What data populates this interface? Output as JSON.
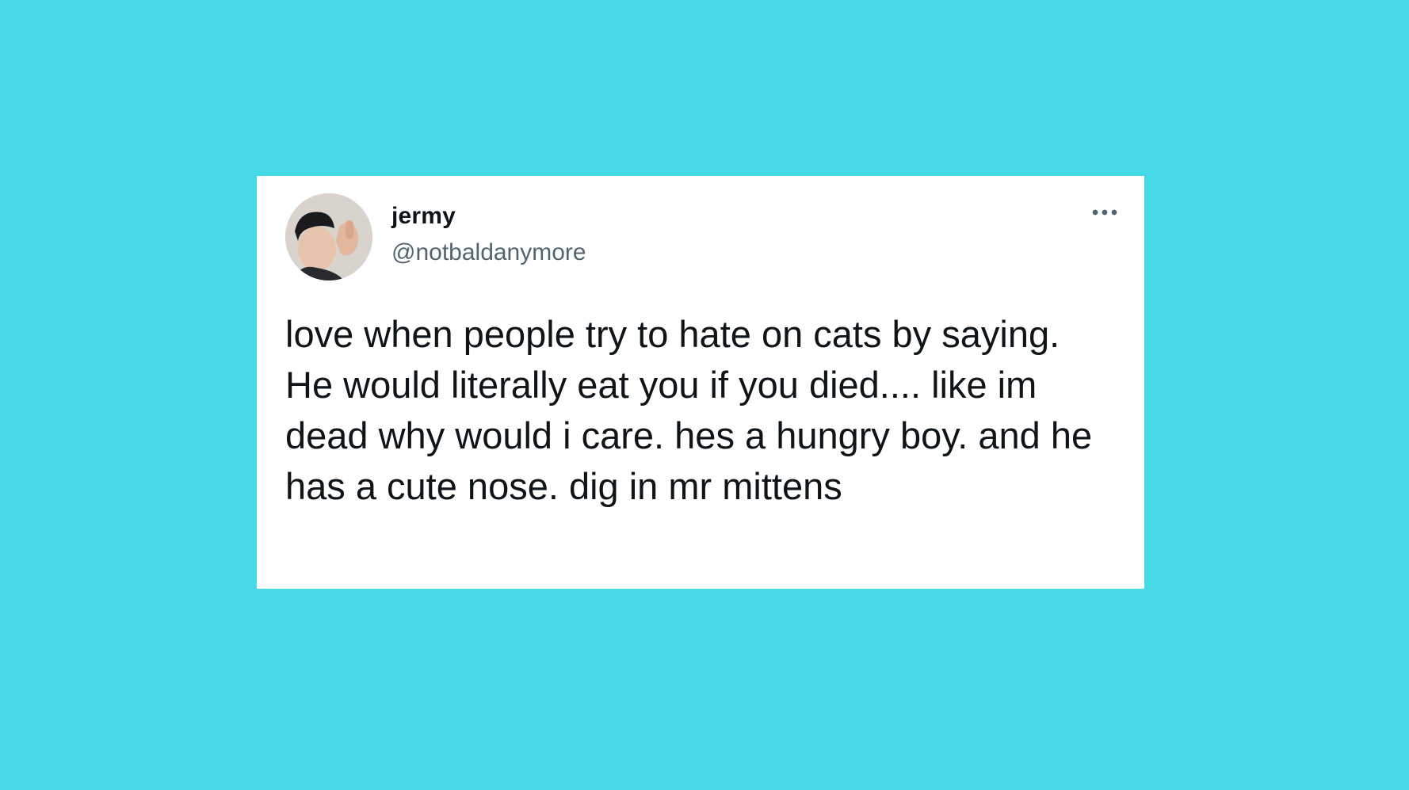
{
  "tweet": {
    "author": {
      "display_name": "jermy",
      "handle": "@notbaldanymore",
      "avatar_icon": "user-avatar-photo"
    },
    "more_icon": "more-options-icon",
    "text": "love when people try to hate on cats by saying. He would literally eat you if you died.... like im dead why would i care. hes a hungry boy. and he has a cute nose. dig in mr mittens"
  },
  "colors": {
    "background": "#46d9e6",
    "card": "#ffffff",
    "text_primary": "#0f1419",
    "text_secondary": "#536471"
  }
}
